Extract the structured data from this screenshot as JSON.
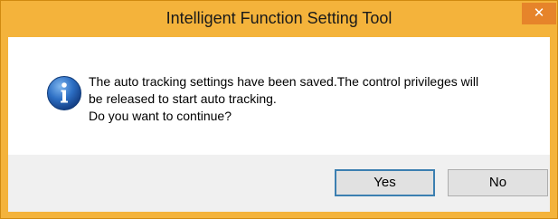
{
  "window": {
    "title": "Intelligent Function Setting Tool",
    "close_glyph": "✕"
  },
  "dialog": {
    "icon": "info-icon",
    "message": "The auto tracking settings have been saved.The control privileges will\nbe released to start auto tracking.\nDo you want to continue?",
    "buttons": {
      "yes_label": "Yes",
      "no_label": "No"
    }
  },
  "colors": {
    "title_bar": "#f4b33b",
    "close_button": "#e6842a",
    "icon_blue": "#1f5fb4",
    "default_button_border": "#3c7fb1"
  }
}
